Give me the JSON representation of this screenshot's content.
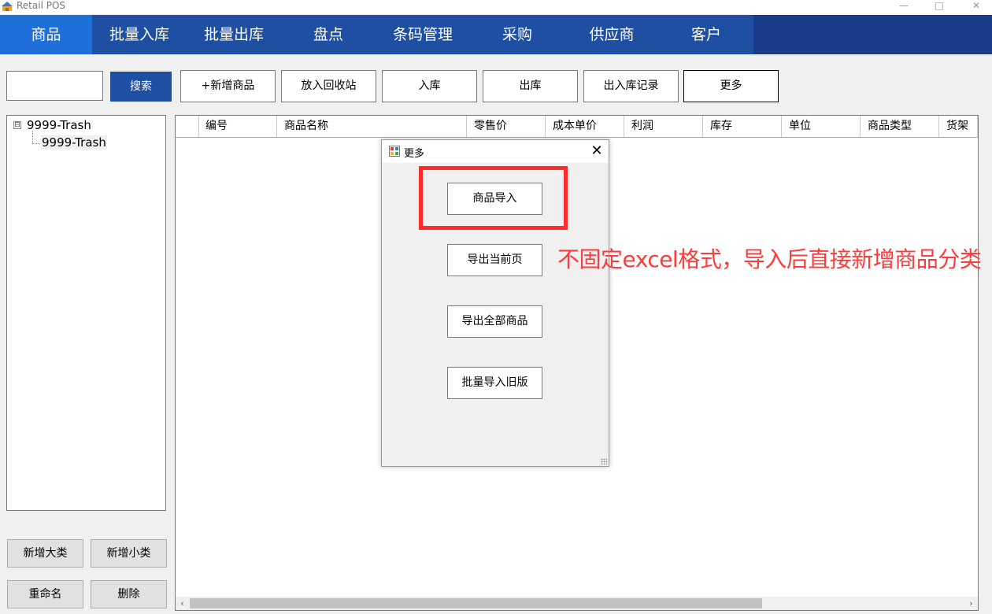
{
  "window": {
    "title": "Retail POS",
    "icon": "app-logo-icon"
  },
  "colors": {
    "menu_bg": "#1e4fa3",
    "menu_active": "#1e6fd9",
    "accent_red": "#ff2a2a"
  },
  "menu": {
    "items": [
      {
        "label": "商品",
        "active": true
      },
      {
        "label": "批量入库"
      },
      {
        "label": "批量出库"
      },
      {
        "label": "盘点"
      },
      {
        "label": "条码管理"
      },
      {
        "label": "采购"
      },
      {
        "label": "供应商"
      },
      {
        "label": "客户"
      }
    ]
  },
  "toolbar": {
    "search_value": "",
    "search_label": "搜索",
    "add_product": "+新增商品",
    "recycle": "放入回收站",
    "stock_in": "入库",
    "stock_out": "出库",
    "records": "出入库记录",
    "more": "更多"
  },
  "tree": {
    "root": "9999-Trash",
    "child": "9999-Trash",
    "expander": "⊟"
  },
  "category_actions": {
    "add_major": "新增大类",
    "add_minor": "新增小类",
    "rename": "重命名",
    "delete": "删除"
  },
  "grid": {
    "columns": [
      "编号",
      "商品名称",
      "零售价",
      "成本单价",
      "利润",
      "库存",
      "单位",
      "商品类型",
      "货架"
    ]
  },
  "dialog": {
    "title": "更多",
    "buttons": {
      "import_products": "商品导入",
      "export_page": "导出当前页",
      "export_all": "导出全部商品",
      "batch_import_old": "批量导入旧版"
    }
  },
  "annotation": {
    "text": "不固定excel格式，导入后直接新增商品分类"
  }
}
